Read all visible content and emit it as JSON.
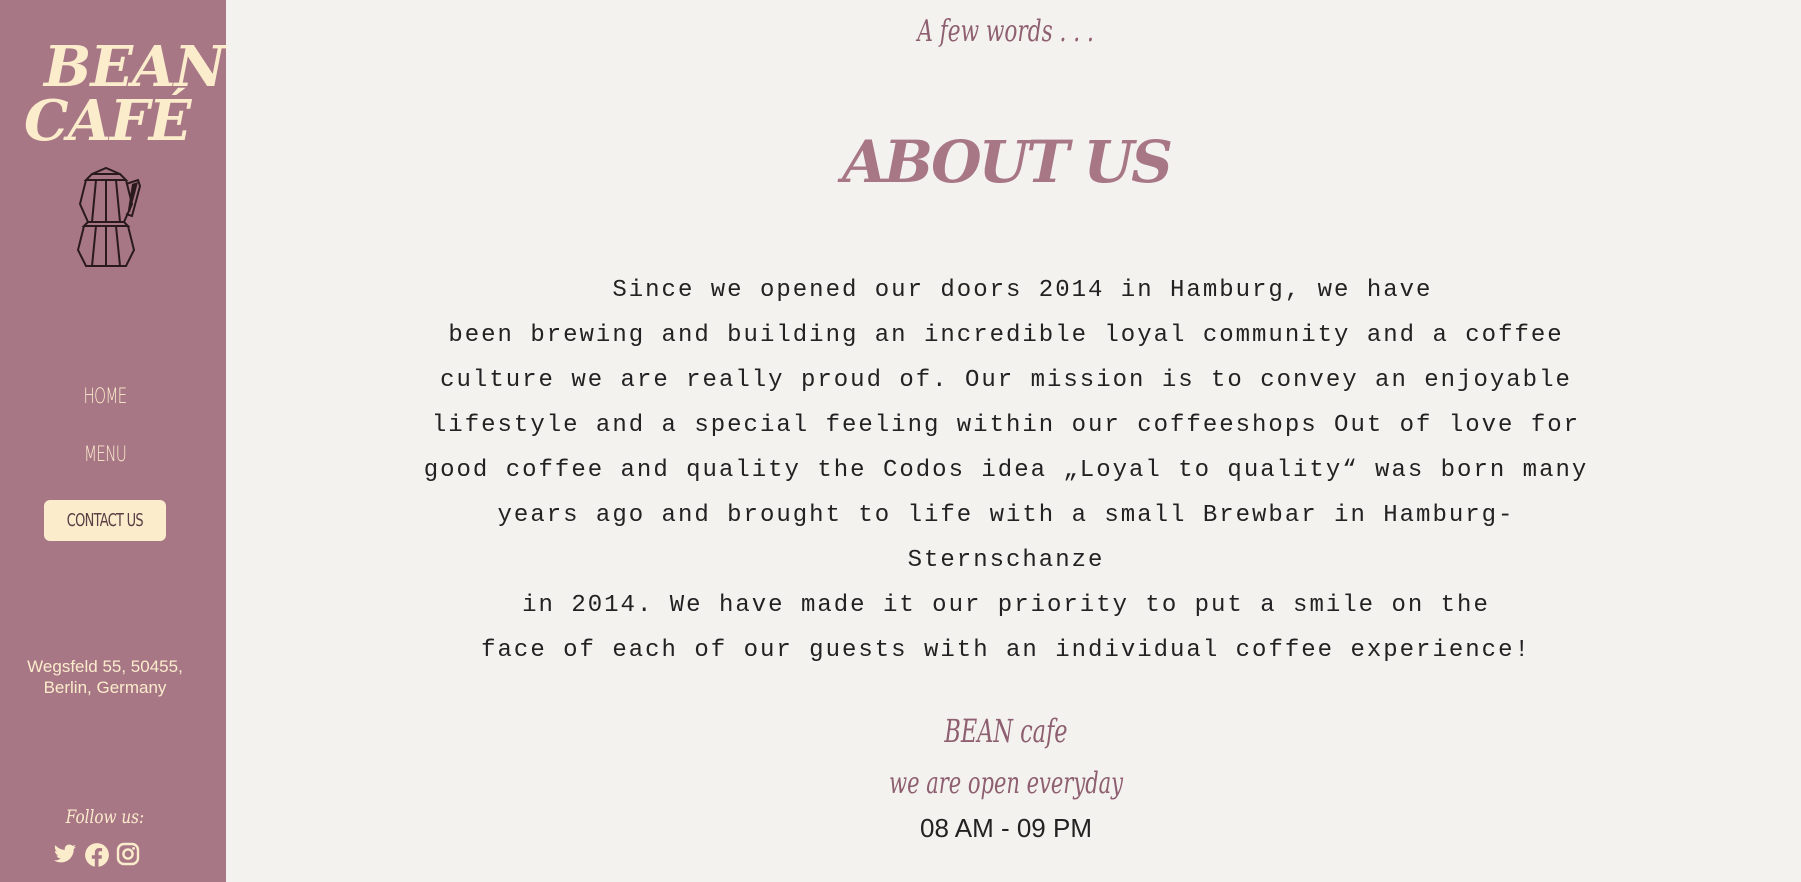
{
  "sidebar": {
    "logo": {
      "line1": "BEAN",
      "line2": "CAFÉ"
    },
    "logo_icon": "moka-pot-icon",
    "nav": {
      "home": "HOME",
      "menu": "MENU",
      "contact": "CONTACT US"
    },
    "address": {
      "line1": "Wegsfeld 55, 50455,",
      "line2": "Berlin, Germany"
    },
    "follow_label": "Follow us:",
    "social_icons": [
      "twitter-icon",
      "facebook-icon",
      "instagram-icon"
    ]
  },
  "main": {
    "kicker": "A few words . . .",
    "title": "ABOUT US",
    "about_lines": [
      "  Since we opened our doors 2014 in Hamburg, we have",
      "been brewing and building an incredible loyal community and a coffee",
      "culture we are really proud of. Our mission is to convey an enjoyable",
      "lifestyle and a special feeling within our coffeeshops Out of love for",
      "good coffee and quality the Codos idea „Loyal to quality“ was born many",
      "years ago and brought to life with a small Brewbar in Hamburg-",
      "Sternschanze",
      "in 2014. We have made it our priority to put a smile on the",
      "face of each of our guests with an individual coffee experience!"
    ],
    "brand": "BEAN cafe",
    "open_text": "we are open everyday",
    "hours": "08 AM - 09 PM"
  },
  "colors": {
    "sidebar_bg": "#a87786",
    "cream": "#fbeccc",
    "accent": "#8e5f70",
    "page_bg": "#f4f2ef"
  }
}
